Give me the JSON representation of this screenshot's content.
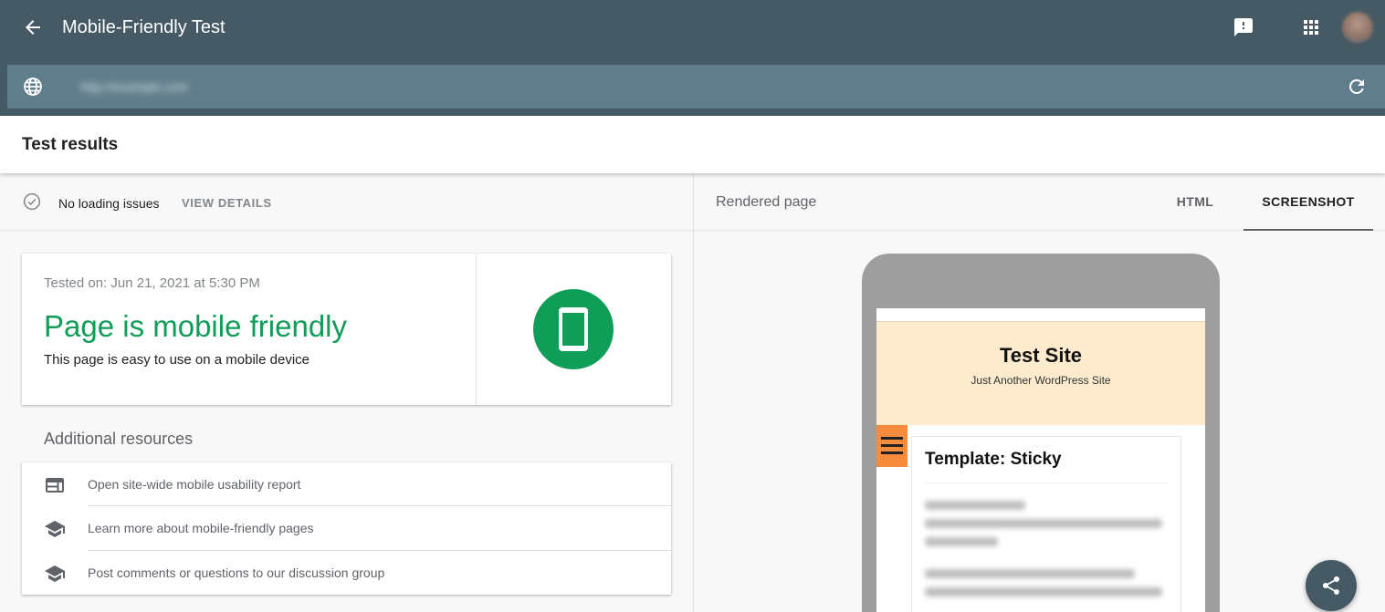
{
  "header": {
    "title": "Mobile-Friendly Test",
    "url": "http://example.com"
  },
  "results": {
    "title": "Test results"
  },
  "status": {
    "text": "No loading issues",
    "action": "VIEW DETAILS"
  },
  "result_card": {
    "tested_on": "Tested on: Jun 21, 2021 at 5:30 PM",
    "headline": "Page is mobile friendly",
    "subtext": "This page is easy to use on a mobile device"
  },
  "additional": {
    "heading": "Additional resources",
    "items": [
      {
        "label": "Open site-wide mobile usability report",
        "icon": "web-report-icon"
      },
      {
        "label": "Learn more about mobile-friendly pages",
        "icon": "school-icon"
      },
      {
        "label": "Post comments or questions to our discussion group",
        "icon": "school-icon"
      }
    ]
  },
  "rendered": {
    "label": "Rendered page",
    "tabs": [
      {
        "label": "HTML",
        "active": false
      },
      {
        "label": "SCREENSHOT",
        "active": true
      }
    ]
  },
  "preview": {
    "site_title": "Test Site",
    "site_tagline": "Just Another WordPress Site",
    "post_title": "Template: Sticky"
  },
  "colors": {
    "appbar": "#455a64",
    "urlbar": "#607d8b",
    "success": "#0f9d58",
    "menu_accent": "#f58b3c"
  }
}
